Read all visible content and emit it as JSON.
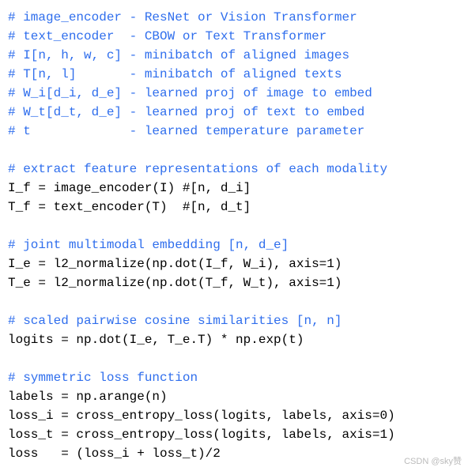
{
  "lines": [
    {
      "cls": "comment",
      "text": "# image_encoder - ResNet or Vision Transformer"
    },
    {
      "cls": "comment",
      "text": "# text_encoder  - CBOW or Text Transformer"
    },
    {
      "cls": "comment",
      "text": "# I[n, h, w, c] - minibatch of aligned images"
    },
    {
      "cls": "comment",
      "text": "# T[n, l]       - minibatch of aligned texts"
    },
    {
      "cls": "comment",
      "text": "# W_i[d_i, d_e] - learned proj of image to embed"
    },
    {
      "cls": "comment",
      "text": "# W_t[d_t, d_e] - learned proj of text to embed"
    },
    {
      "cls": "comment",
      "text": "# t             - learned temperature parameter"
    },
    {
      "cls": "code",
      "text": ""
    },
    {
      "cls": "comment",
      "text": "# extract feature representations of each modality"
    },
    {
      "cls": "code",
      "text": "I_f = image_encoder(I) #[n, d_i]"
    },
    {
      "cls": "code",
      "text": "T_f = text_encoder(T)  #[n, d_t]"
    },
    {
      "cls": "code",
      "text": ""
    },
    {
      "cls": "comment",
      "text": "# joint multimodal embedding [n, d_e]"
    },
    {
      "cls": "code",
      "text": "I_e = l2_normalize(np.dot(I_f, W_i), axis=1)"
    },
    {
      "cls": "code",
      "text": "T_e = l2_normalize(np.dot(T_f, W_t), axis=1)"
    },
    {
      "cls": "code",
      "text": ""
    },
    {
      "cls": "comment",
      "text": "# scaled pairwise cosine similarities [n, n]"
    },
    {
      "cls": "code",
      "text": "logits = np.dot(I_e, T_e.T) * np.exp(t)"
    },
    {
      "cls": "code",
      "text": ""
    },
    {
      "cls": "comment",
      "text": "# symmetric loss function"
    },
    {
      "cls": "code",
      "text": "labels = np.arange(n)"
    },
    {
      "cls": "code",
      "text": "loss_i = cross_entropy_loss(logits, labels, axis=0)"
    },
    {
      "cls": "code",
      "text": "loss_t = cross_entropy_loss(logits, labels, axis=1)"
    },
    {
      "cls": "code",
      "text": "loss   = (loss_i + loss_t)/2"
    }
  ],
  "watermark": "CSDN @sky赞"
}
